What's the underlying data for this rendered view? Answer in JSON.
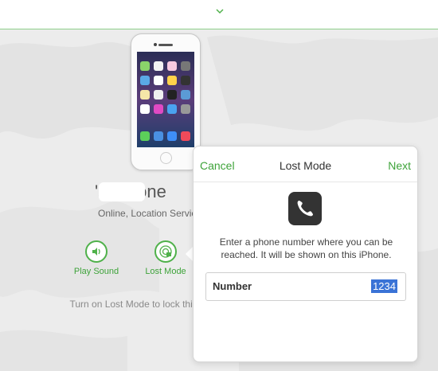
{
  "header": {
    "chevron_icon": "chevron-down-icon"
  },
  "device": {
    "name": "'s iPhone",
    "status": "Online, Location Services Off"
  },
  "actions": {
    "play_sound": "Play Sound",
    "lost_mode": "Lost Mode"
  },
  "description": "Turn on Lost Mode to lock this iPhone and track its location.",
  "popover": {
    "cancel": "Cancel",
    "title": "Lost Mode",
    "next": "Next",
    "icon": "phone-icon",
    "instructions": "Enter a phone number where you can be reached. It will be shown on this iPhone.",
    "number_label": "Number",
    "number_value": "1234"
  },
  "colors": {
    "accent": "#3ea33a",
    "selection": "#3a73d6"
  }
}
